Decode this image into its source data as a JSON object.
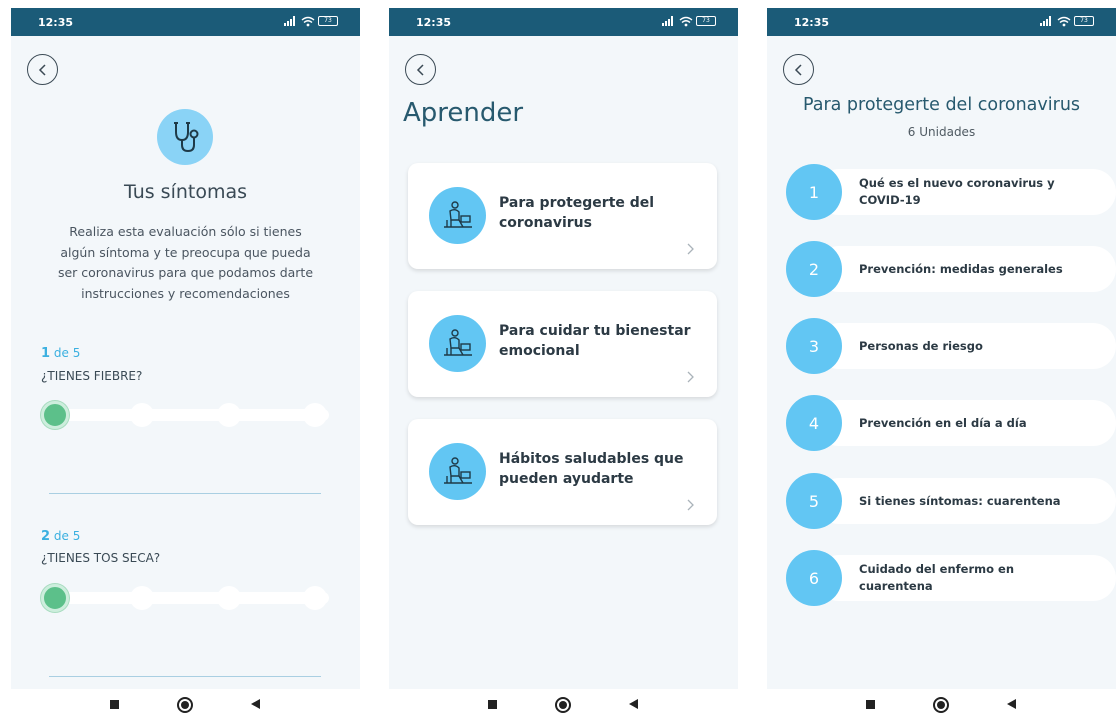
{
  "status_bar": {
    "time": "12:35",
    "battery": "73"
  },
  "symptoms_screen": {
    "title": "Tus síntomas",
    "description": "Realiza esta evaluación sólo si tienes algún síntoma y te preocupa que pueda ser coronavirus para que podamos darte instrucciones y recomendaciones",
    "questions": [
      {
        "number": "1",
        "of_label": "de 5",
        "text": "¿TIENES FIEBRE?",
        "slider_level": 0
      },
      {
        "number": "2",
        "of_label": "de 5",
        "text": "¿TIENES TOS SECA?",
        "slider_level": 0
      }
    ]
  },
  "learn_screen": {
    "title": "Aprender",
    "cards": [
      {
        "label": "Para protegerte del coronavirus"
      },
      {
        "label": "Para cuidar tu bienestar emocional"
      },
      {
        "label": "Hábitos saludables que pueden ayudarte"
      }
    ]
  },
  "course_screen": {
    "title": "Para protegerte del coronavirus",
    "subtitle": "6 Unidades",
    "units": [
      {
        "number": "1",
        "label": "Qué es el nuevo coronavirus y COVID-19"
      },
      {
        "number": "2",
        "label": "Prevención: medidas generales"
      },
      {
        "number": "3",
        "label": "Personas de riesgo"
      },
      {
        "number": "4",
        "label": "Prevención en el día a día"
      },
      {
        "number": "5",
        "label": "Si tienes síntomas: cuarentena"
      },
      {
        "number": "6",
        "label": "Cuidado del enfermo en cuarentena"
      }
    ]
  },
  "colors": {
    "status_bar": "#1b5b78",
    "accent_blue": "#62c6f3",
    "slider_green": "#5cc08a",
    "title_teal": "#27596e"
  },
  "icons": {
    "back": "back-arrow-icon",
    "symptoms": "stethoscope-icon",
    "card": "person-at-desk-icon",
    "card_chevron": "chevron-right-icon"
  }
}
